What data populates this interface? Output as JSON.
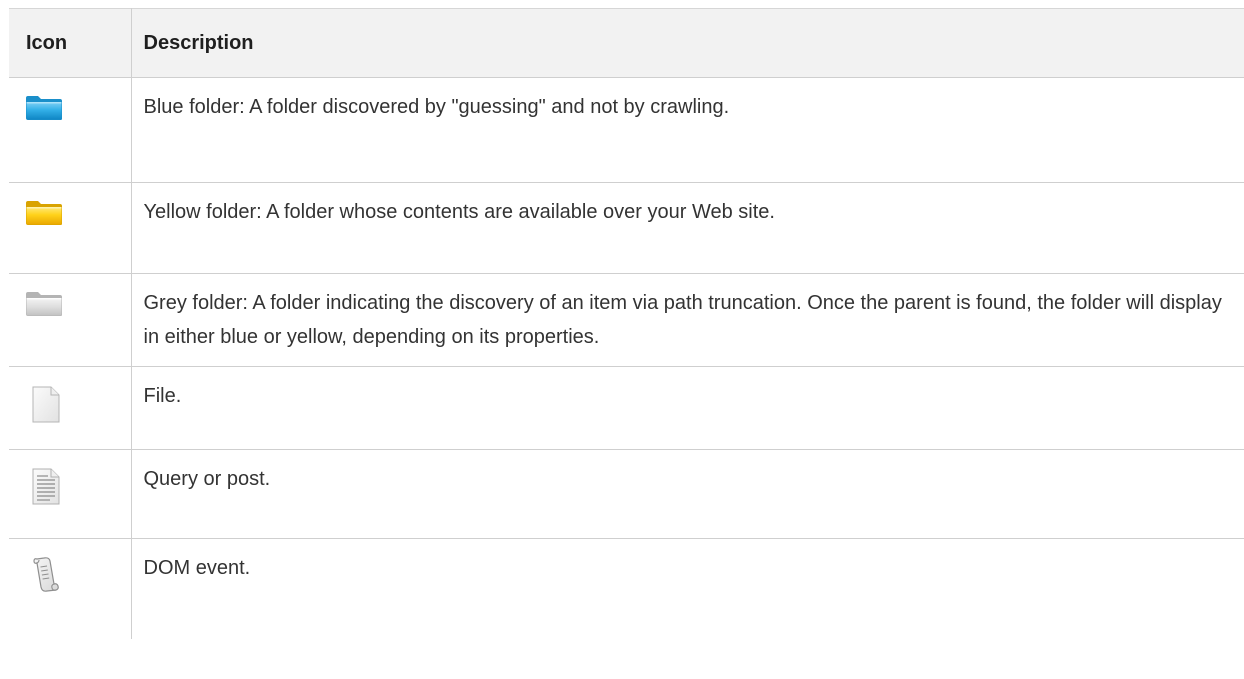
{
  "table": {
    "headers": {
      "icon": "Icon",
      "description": "Description"
    },
    "rows": [
      {
        "icon": "blue-folder-icon",
        "description": "Blue folder: A folder discovered by \"guessing\" and not by crawling."
      },
      {
        "icon": "yellow-folder-icon",
        "description": "Yellow folder: A folder whose contents are available over your Web site."
      },
      {
        "icon": "grey-folder-icon",
        "description": "Grey folder: A folder indicating the discovery of an item via path truncation. Once the parent is found, the folder will display in either blue or yellow, depending on its properties."
      },
      {
        "icon": "file-icon",
        "description": "File."
      },
      {
        "icon": "query-post-icon",
        "description": "Query or post."
      },
      {
        "icon": "dom-event-scroll-icon",
        "description": "DOM event."
      }
    ]
  },
  "colors": {
    "header_bg": "#f2f2f2",
    "border": "#cfcfcf",
    "blue_folder": "#2aa6e0",
    "yellow_folder": "#f5c400",
    "grey_folder": "#c8c8c8"
  }
}
